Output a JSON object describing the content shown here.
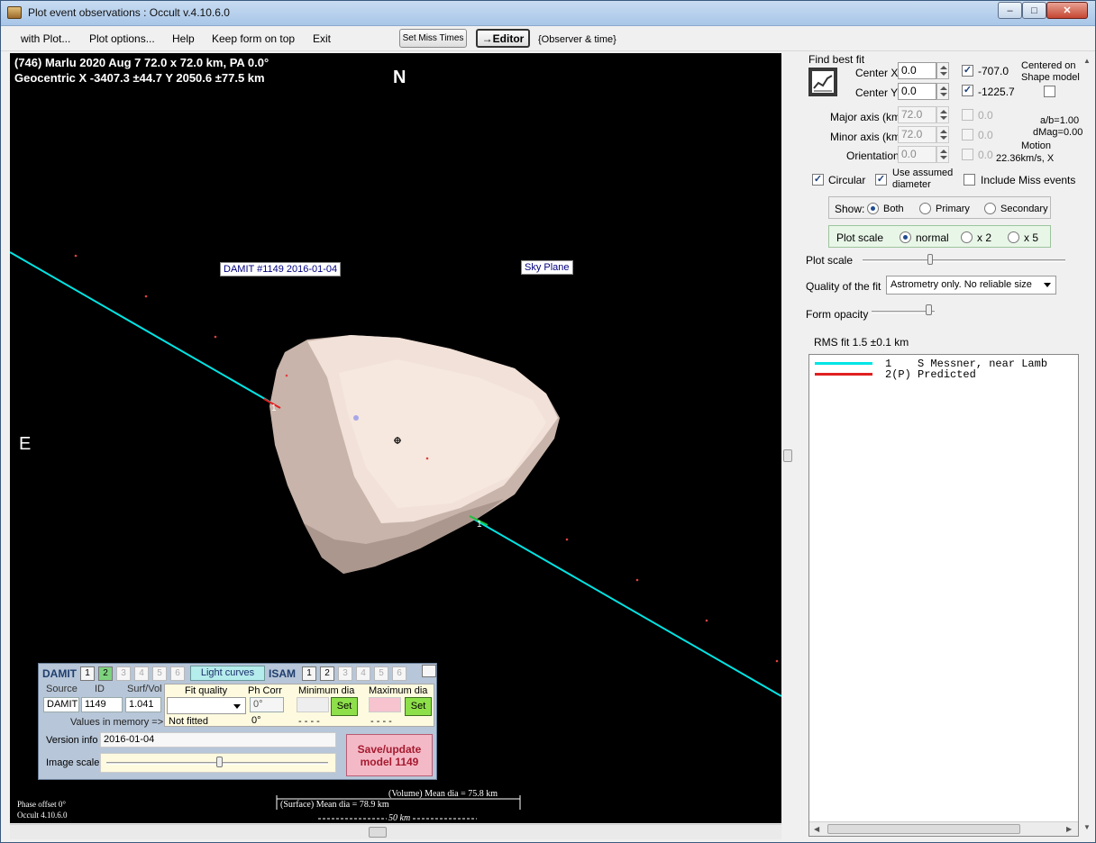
{
  "window": {
    "title": "Plot event observations : Occult v.4.10.6.0",
    "min_label": "–",
    "max_label": "□",
    "close_label": "✕"
  },
  "menu": {
    "with_plot": "with Plot...",
    "plot_options": "Plot options...",
    "help": "Help",
    "keep_on_top": "Keep form on top",
    "exit": "Exit",
    "set_miss_times": "Set Miss Times",
    "editor": "→Editor",
    "observer_time": "{Observer & time}"
  },
  "plot": {
    "header_line1": "(746) Marlu  2020 Aug 7  72.0 x 72.0 km, PA 0.0°",
    "header_line2": "Geocentric  X  -3407.3 ±44.7  Y 2050.6 ±77.5 km",
    "north": "N",
    "east": "E",
    "damit_tag": "DAMIT #1149 2016-01-04",
    "sky_plane_tag": "Sky Plane",
    "chord_labels": [
      "1",
      "1"
    ],
    "volume_dia": "(Volume) Mean dia = 75.8 km",
    "surface_dia": "(Surface) Mean dia = 78.9 km",
    "scale_bar": "50 km",
    "phase_offset": "Phase offset 0°",
    "version": "Occult 4.10.6.0",
    "colors": {
      "chord": "#00e5e5",
      "shape": "#e8d4c8",
      "background": "#000000"
    }
  },
  "fit": {
    "find_best_fit": "Find best fit",
    "center_x_label": "Center X",
    "center_x_value": "0.0",
    "center_x_fixed": "-707.0",
    "center_y_label": "Center Y",
    "center_y_value": "0.0",
    "center_y_fixed": "-1225.7",
    "centered_on": "Centered on",
    "shape_model": "Shape model",
    "major_label": "Major axis (km)",
    "major_value": "72.0",
    "major_fixed": "0.0",
    "minor_label": "Minor axis (km)",
    "minor_value": "72.0",
    "minor_fixed": "0.0",
    "orient_label": "Orientation",
    "orient_value": "0.0",
    "orient_fixed": "0.0",
    "ab": "a/b=1.00",
    "dmag": "dMag=0.00",
    "motion_label": "Motion",
    "motion_value": "22.36km/s, X",
    "circular": "Circular",
    "use_assumed": "Use assumed",
    "diameter": "diameter",
    "include_miss": "Include Miss events",
    "show_label": "Show:",
    "show_both": "Both",
    "show_primary": "Primary",
    "show_secondary": "Secondary",
    "plot_scale_group": "Plot scale",
    "scale_normal": "normal",
    "scale_x2": "x 2",
    "scale_x5": "x 5",
    "plot_scale_slider": "Plot scale",
    "quality_label": "Quality of the fit",
    "quality_value": "Astrometry only. No reliable size",
    "form_opacity": "Form opacity",
    "rms_fit": "RMS fit  1.5 ±0.1 km"
  },
  "observers": [
    {
      "num": "1",
      "name": "S Messner, near Lamb",
      "color": "#00e5e5"
    },
    {
      "num": "2(P)",
      "name": "Predicted",
      "color": "#e02020"
    }
  ],
  "damit_panel": {
    "damit": "DAMIT",
    "isam": "ISAM",
    "damit_nums": [
      "1",
      "2",
      "3",
      "4",
      "5",
      "6"
    ],
    "isam_nums": [
      "1",
      "2",
      "3",
      "4",
      "5",
      "6"
    ],
    "light_curves": "Light curves",
    "source_hdr": "Source",
    "id_hdr": "ID",
    "surfvol_hdr": "Surf/Vol",
    "source_val": "DAMIT",
    "id_val": "1149",
    "surfvol_val": "1.041",
    "values_in_memory": "Values in memory =>",
    "fit_quality_hdr": "Fit quality",
    "ph_corr_hdr": "Ph Corr",
    "min_dia_hdr": "Minimum dia",
    "max_dia_hdr": "Maximum dia",
    "ph_corr_val": "0°",
    "not_fitted": "Not fitted",
    "ph_corr_mem": "0°",
    "min_dash": "- - - -",
    "max_dash": "- - - -",
    "set": "Set",
    "version_info_label": "Version info",
    "version_info_value": "2016-01-04",
    "image_scale": "Image scale",
    "save_line1": "Save/update",
    "save_line2": "model  1149"
  }
}
